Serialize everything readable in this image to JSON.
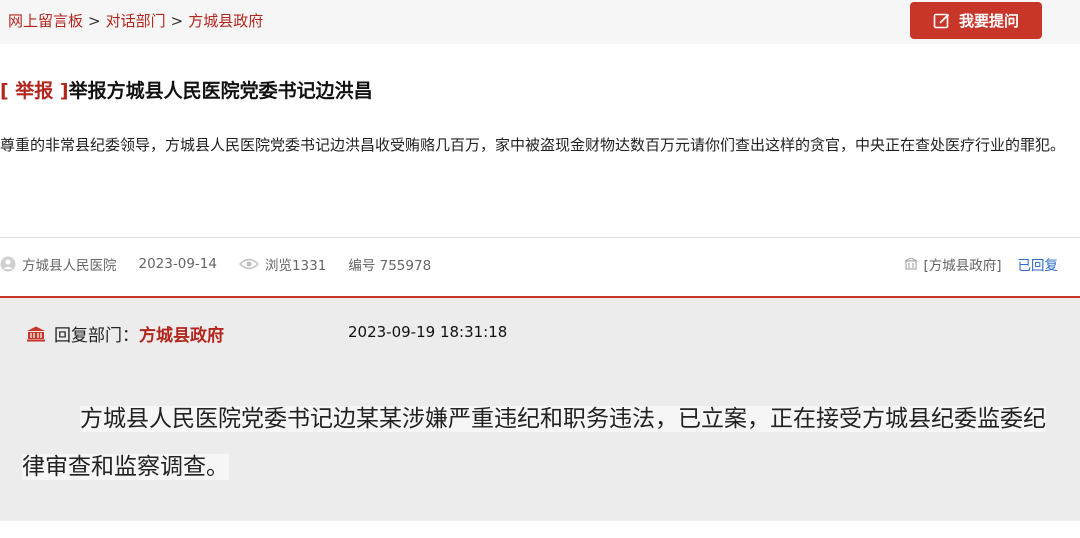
{
  "breadcrumb": {
    "items": [
      "网上留言板",
      "对话部门",
      "方城县政府"
    ],
    "separator": ">"
  },
  "header": {
    "ask_button_label": "我要提问",
    "ask_button_icon": "edit-icon"
  },
  "post": {
    "tag": "[ 举报 ]",
    "title": "举报方城县人民医院党委书记边洪昌",
    "content": "尊重的非常县纪委领导，方城县人民医院党委书记边洪昌收受贿赂几百万，家中被盗现金财物达数百万元请你们查出这样的贪官，中央正在查处医疗行业的罪犯。"
  },
  "meta": {
    "author": "方城县人民医院",
    "date": "2023-09-14",
    "views": "浏览1331",
    "number": "编号 755978",
    "department": "[方城县政府]",
    "status": "已回复"
  },
  "reply": {
    "label": "回复部门：",
    "department": "方城县政府",
    "time": "2023-09-19 18:31:18",
    "content": "方城县人民医院党委书记边某某涉嫌严重违纪和职务违法，已立案，正在接受方城县纪委监委纪律审查和监察调查。"
  },
  "colors": {
    "accent": "#c8362a",
    "link_red": "#b3261e",
    "status_blue": "#2c6ac7"
  }
}
